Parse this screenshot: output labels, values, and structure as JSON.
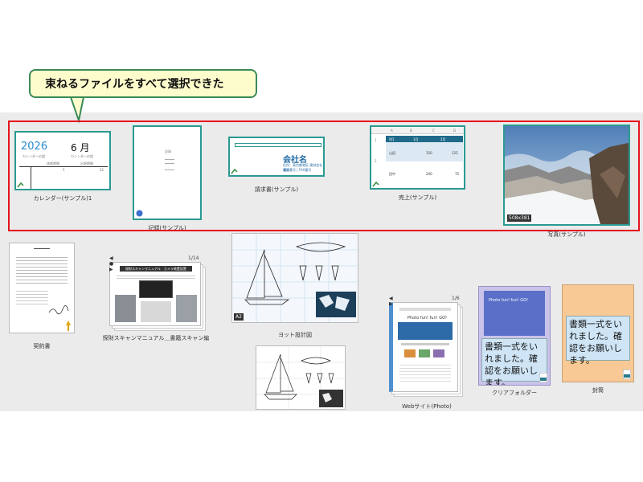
{
  "callout": {
    "text": "束ねるファイルをすべて選択できた"
  },
  "selected_items": [
    {
      "caption": "カレンダー(サンプル)1",
      "year": "2026",
      "month": "6 月",
      "sub_left": "カレンダーの説",
      "sub_right": "カレンダーの説",
      "cell_a": "5",
      "cell_b": "02",
      "col_a": "休暇期間",
      "col_b": "出張期間"
    },
    {
      "caption": "記録(サンプル)",
      "heading": "記録"
    },
    {
      "caption": "請求書(サンプル)",
      "company": "会社名",
      "lines": [
        "住所：東京都港区 建材会社 通常",
        "電話番号 | FAX番号"
      ]
    },
    {
      "caption": "売上(サンプル)",
      "cols": [
        "A",
        "B",
        "C",
        "D"
      ],
      "headers": [
        "列1",
        "1月",
        "2月"
      ],
      "rows": [
        {
          "label": "山田",
          "v1": "150",
          "v2": "125"
        },
        {
          "label": "田中",
          "v1": "200",
          "v2": "75"
        }
      ],
      "row_nums": [
        "1",
        "2"
      ]
    },
    {
      "caption": "写真(サンプル)",
      "dimensions": "508x381"
    }
  ],
  "other_items": [
    {
      "caption": "契約書"
    },
    {
      "caption": "探財スキャンマニュアル＿書籍スキャン編",
      "page_counter": "1/14",
      "header": "探財スキャンマニュアル　カメラ装置設置"
    },
    {
      "caption": "ヨット設計図",
      "badge": "A2"
    },
    {
      "caption": "Webサイト(Photo)",
      "page_counter": "1/6",
      "site_title": "Photo fun! fun! GO!"
    },
    {
      "caption": "クリアフォルダー",
      "site_title": "Photo fun! fun! GO!",
      "note": "書類一式をいれました。確認をお願いします。"
    },
    {
      "caption": "封筒",
      "note": "書類一式をいれました。確認をお願いします。"
    },
    {
      "caption": ""
    }
  ],
  "colors": {
    "selection": "#e4141c",
    "callout_bg": "#fdfccc",
    "callout_border": "#3a8a58",
    "thumb_sel": "#2a9a92",
    "workspace": "#ebebeb"
  }
}
